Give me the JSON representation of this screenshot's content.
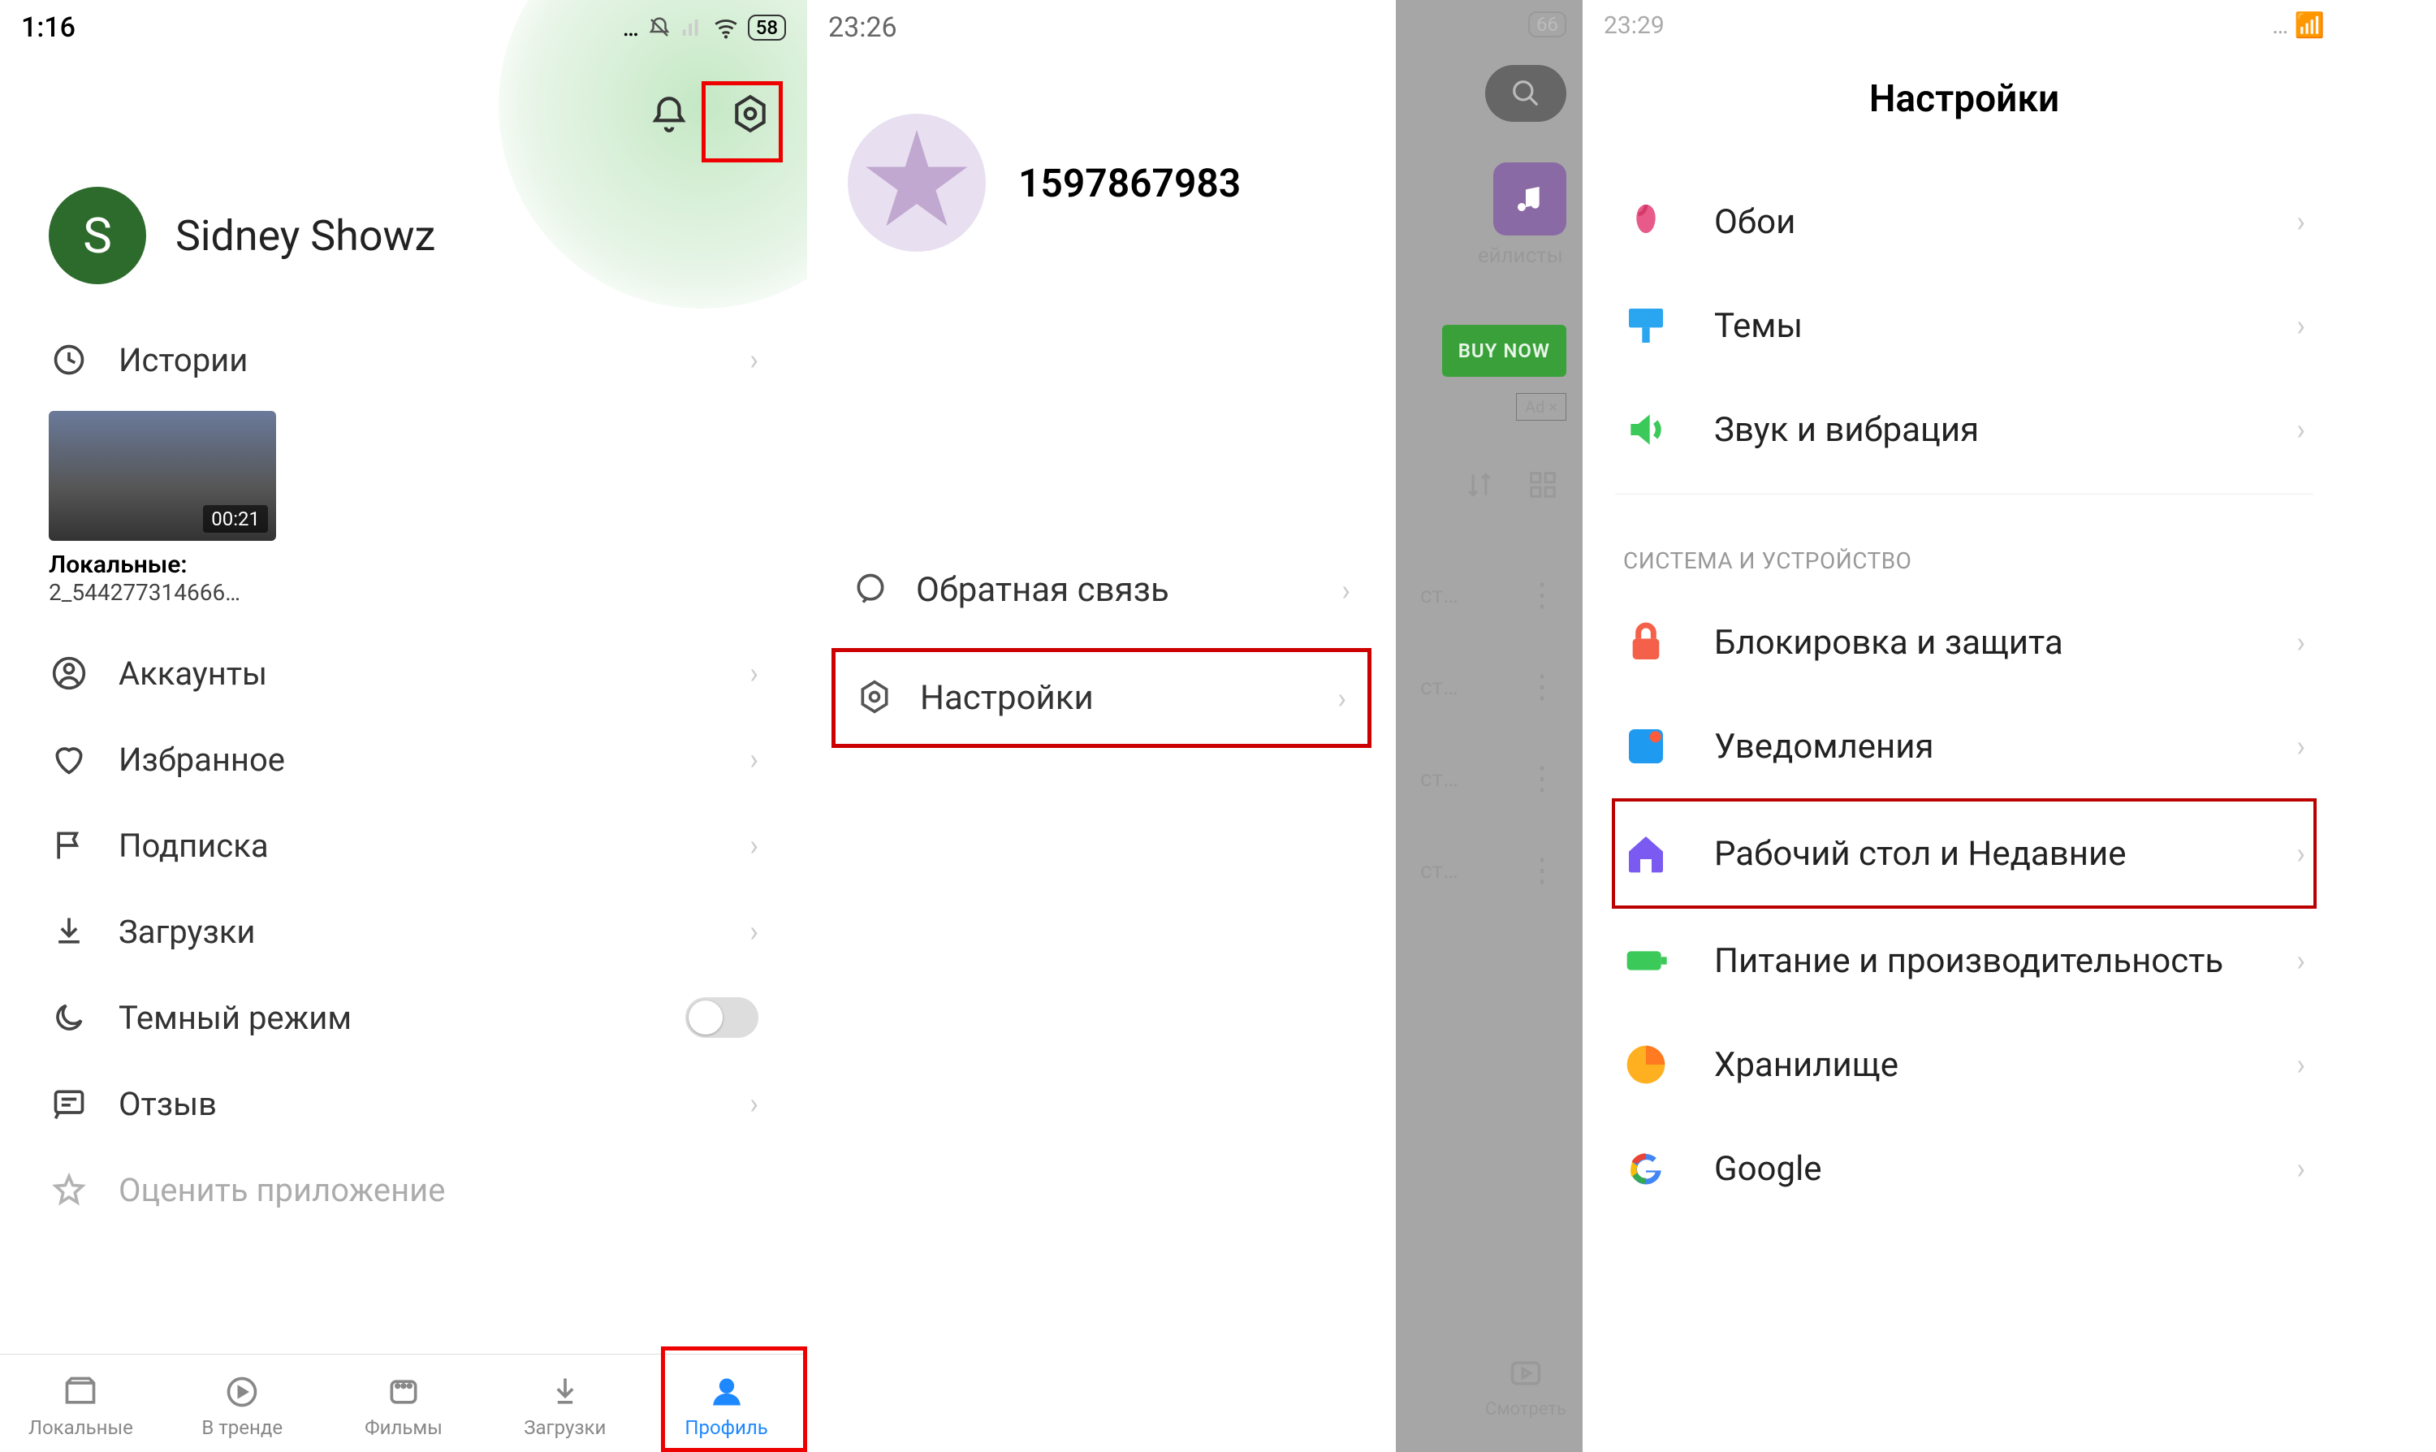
{
  "panel1": {
    "status_time": "1:16",
    "battery": "58",
    "user_initial": "S",
    "user_name": "Sidney Showz",
    "history_label": "Истории",
    "story_duration": "00:21",
    "story_caption1": "Локальные:",
    "story_caption2": "2_544277314666…",
    "menu": {
      "accounts": "Аккаунты",
      "favorite": "Избранное",
      "subscribe": "Подписка",
      "downloads": "Загрузки",
      "darkmode": "Темный режим",
      "feedback": "Отзыв",
      "rate": "Оценить приложение"
    },
    "nav": {
      "local": "Локальные",
      "trending": "В тренде",
      "movies": "Фильмы",
      "downloads": "Загрузки",
      "profile": "Профиль"
    }
  },
  "panel2": {
    "status_time": "23:26",
    "user_id": "1597867983",
    "feedback": "Обратная связь",
    "settings": "Настройки"
  },
  "panel3": {
    "battery": "66",
    "playlists": "ейлисты",
    "buy": "BUY NOW",
    "ad": "Ad ×",
    "row_suffix": "ст…",
    "watch": "Смотреть"
  },
  "panel4": {
    "status_time": "23:29",
    "title": "Настройки",
    "section_system": "СИСТЕМА И УСТРОЙСТВО",
    "items": {
      "wallpaper": "Обои",
      "themes": "Темы",
      "sound": "Звук и вибрация",
      "lock": "Блокировка и защита",
      "notifications": "Уведомления",
      "home": "Рабочий стол и Недавние",
      "battery": "Питание и производительность",
      "storage": "Хранилище",
      "google": "Google"
    }
  }
}
